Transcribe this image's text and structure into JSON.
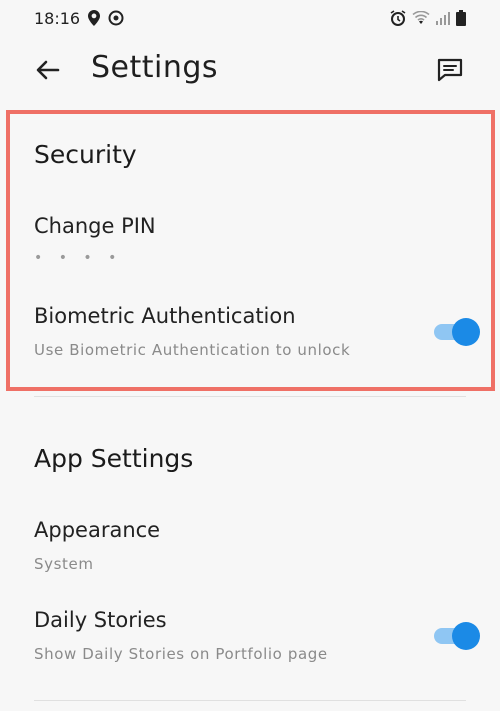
{
  "status": {
    "time": "18:16",
    "icons": [
      "location-icon",
      "gps-icon",
      "alarm-icon",
      "wifi-icon",
      "signal-icon",
      "battery-icon"
    ]
  },
  "header": {
    "title": "Settings",
    "back_icon": "back-arrow-icon",
    "feedback_icon": "feedback-icon"
  },
  "security": {
    "title": "Security",
    "change_pin": {
      "label": "Change PIN",
      "value": "• • • •"
    },
    "biometric": {
      "label": "Biometric Authentication",
      "description": "Use Biometric Authentication to unlock",
      "enabled": true
    }
  },
  "app_settings": {
    "title": "App Settings",
    "appearance": {
      "label": "Appearance",
      "value": "System"
    },
    "daily_stories": {
      "label": "Daily Stories",
      "description": "Show Daily Stories on Portfolio page",
      "enabled": true
    }
  },
  "colors": {
    "accent": "#1b8ae6",
    "accent_track": "#8fc6f3",
    "highlight": "#ef7066",
    "background": "#f7f7f7"
  }
}
